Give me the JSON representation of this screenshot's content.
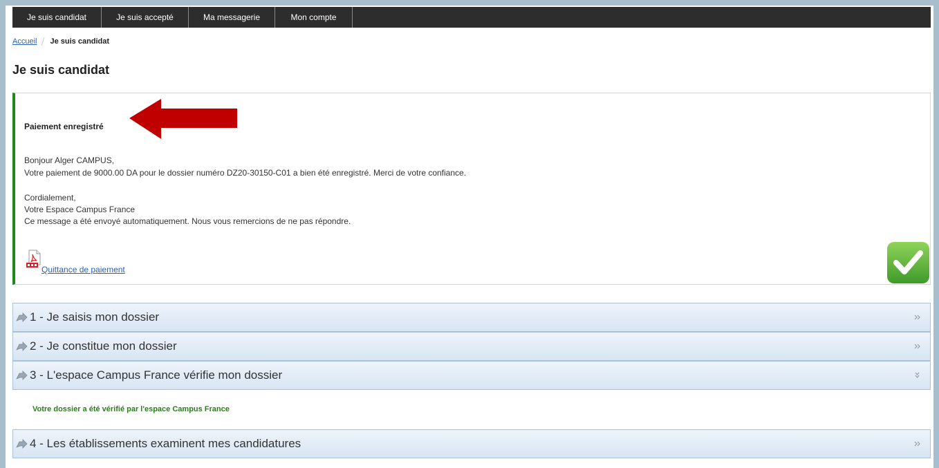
{
  "nav": {
    "items": [
      {
        "label": "Je suis candidat"
      },
      {
        "label": "Je suis accepté"
      },
      {
        "label": "Ma messagerie"
      },
      {
        "label": "Mon compte"
      }
    ]
  },
  "breadcrumb": {
    "home": "Accueil",
    "current": "Je suis candidat"
  },
  "page_title": "Je suis candidat",
  "message": {
    "title": "Paiement enregistré",
    "greeting": "Bonjour Alger CAMPUS,",
    "body": "Votre paiement de 9000.00 DA pour le dossier numéro DZ20-30150-C01 a bien été enregistré. Merci de votre confiance.",
    "closing": "Cordialement,",
    "signature": "Votre Espace Campus France",
    "notice": "Ce message a été envoyé automatiquement. Nous vous remercions de ne pas répondre.",
    "attachment": {
      "label": "Quittance de paiement",
      "icon": "pdf-icon"
    },
    "status_icon": "checkmark-icon",
    "annotation": "red-arrow-pointing-left"
  },
  "steps": [
    {
      "label": "1 - Je saisis mon dossier",
      "state": "collapsed",
      "icon": "arrow-right-icon"
    },
    {
      "label": "2 - Je constitue mon dossier",
      "state": "collapsed",
      "icon": "arrow-right-icon"
    },
    {
      "label": "3 - L'espace Campus France vérifie mon dossier",
      "state": "expanded",
      "icon": "arrow-right-icon",
      "content": "Votre dossier a été vérifié par l'espace Campus France"
    },
    {
      "label": "4 - Les établissements examinent mes candidatures",
      "state": "collapsed",
      "icon": "arrow-right-icon"
    }
  ],
  "colors": {
    "frame": "#a7bfcc",
    "nav_background": "#2d2d2d",
    "message_accent": "#1e8a1e",
    "annotation_red": "#c00000",
    "link": "#2f5fae",
    "step_border": "#a9c2da",
    "step_background": "#e3edf7",
    "verified_text": "#2b7d1c"
  }
}
